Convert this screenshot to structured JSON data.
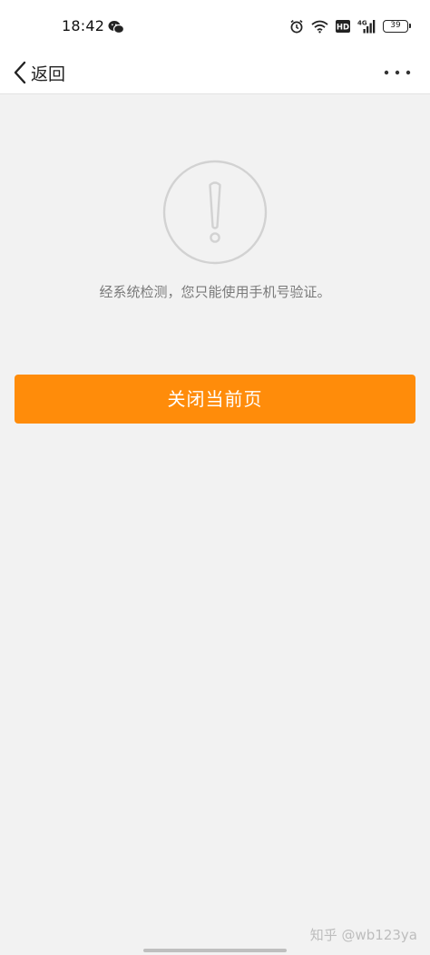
{
  "status_bar": {
    "time": "18:42",
    "network": "4G",
    "hd": "HD",
    "battery": "39"
  },
  "nav": {
    "back_label": "返回"
  },
  "main": {
    "message": "经系统检测，您只能使用手机号验证。",
    "close_button_label": "关闭当前页"
  },
  "watermark": "知乎 @wb123ya",
  "colors": {
    "accent": "#ff8c0a",
    "background": "#f2f2f2"
  },
  "icons": [
    "wechat-icon",
    "alarm-icon",
    "wifi-icon",
    "hd-icon",
    "signal-icon",
    "battery-icon",
    "back-chevron-icon",
    "more-icon",
    "warning-icon"
  ]
}
